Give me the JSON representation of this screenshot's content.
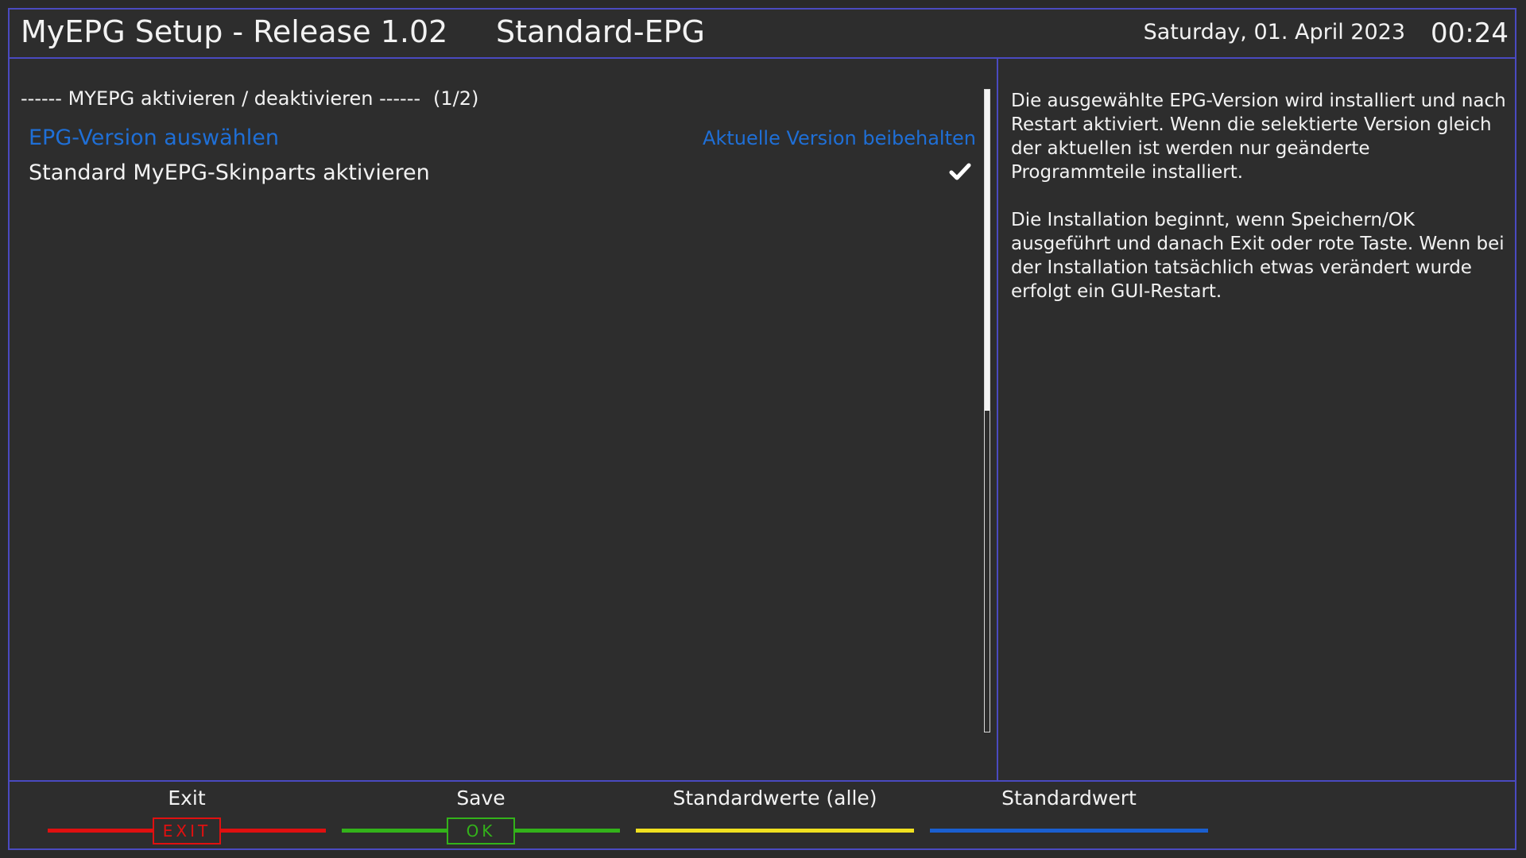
{
  "header": {
    "app_title": "MyEPG Setup - Release 1.02",
    "screen_title": "Standard-EPG",
    "date": "Saturday, 01. April 2023",
    "time": "00:24"
  },
  "list": {
    "section_title": "------ MYEPG aktivieren / deaktivieren ------",
    "page_indicator": "(1/2)",
    "items": [
      {
        "label": "EPG-Version auswählen",
        "value": "Aktuelle Version beibehalten",
        "selected": true
      },
      {
        "label": "Standard MyEPG-Skinparts aktivieren",
        "checked": true
      }
    ],
    "scroll_fraction": 0.5
  },
  "help": {
    "paragraph_1": "Die ausgewählte EPG-Version wird installiert und nach Restart aktiviert. Wenn die selektierte Version gleich der aktuellen ist werden nur geänderte Programmteile installiert.",
    "paragraph_2": "Die Installation beginnt, wenn Speichern/OK ausgeführt und danach Exit oder rote Taste. Wenn bei der Installation tatsächlich etwas verändert wurde erfolgt ein GUI-Restart."
  },
  "footer": {
    "keys": [
      {
        "label": "Exit",
        "badge": "EXIT",
        "color": "#e01010"
      },
      {
        "label": "Save",
        "badge": "OK",
        "color": "#33b21a"
      },
      {
        "label": "Standardwerte (alle)",
        "color": "#f0e020"
      },
      {
        "label": "Standardwert",
        "color": "#1a5fd0"
      }
    ]
  },
  "colors": {
    "accent_border": "#4a4ac0",
    "selected_text": "#1f6fd6"
  }
}
